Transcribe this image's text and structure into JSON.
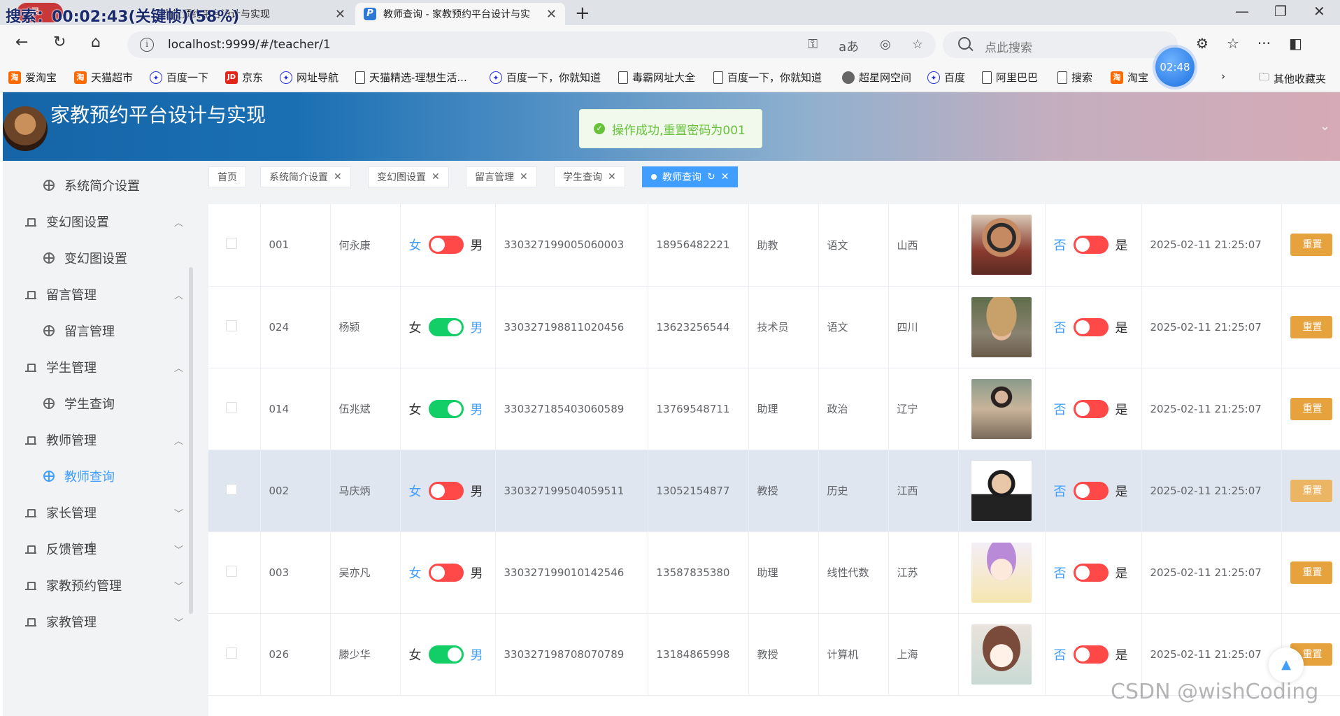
{
  "overlay": {
    "recording_text": "搜索：00:02:43(关键帧)(58%)",
    "rec_badge": "录"
  },
  "browser": {
    "inactive_tab": "家教预约平台设计与实现",
    "active_tab": "教师查询 - 家教预约平台设计与实",
    "url": "localhost:9999/#/teacher/1",
    "search_placeholder": "点此搜索",
    "clock": "02:48",
    "bookmarks": [
      {
        "label": "爱淘宝",
        "icon": "taobao-icon"
      },
      {
        "label": "天猫超市",
        "icon": "taobao-icon"
      },
      {
        "label": "百度一下",
        "icon": "baidu-icon"
      },
      {
        "label": "京东",
        "icon": "jd-icon"
      },
      {
        "label": "网址导航",
        "icon": "baidu-icon"
      },
      {
        "label": "天猫精选-理想生活...",
        "icon": "doc-icon"
      },
      {
        "label": "百度一下，你就知道",
        "icon": "baidu-icon"
      },
      {
        "label": "毒霸网址大全",
        "icon": "doc-icon"
      },
      {
        "label": "百度一下，你就知道",
        "icon": "doc-icon"
      },
      {
        "label": "超星网空间",
        "icon": "globe-icon"
      },
      {
        "label": "百度",
        "icon": "baidu-icon"
      },
      {
        "label": "阿里巴巴",
        "icon": "doc-icon"
      },
      {
        "label": "搜索",
        "icon": "doc-icon"
      },
      {
        "label": "淘宝",
        "icon": "taobao-icon"
      }
    ],
    "other_bookmarks": "其他收藏夹"
  },
  "app": {
    "title": "家教预约平台设计与实现",
    "toast": "操作成功,重置密码为001",
    "accent": "#409eff",
    "warning": "#e6a23c"
  },
  "sidebar": {
    "items": [
      {
        "type": "sub",
        "label": "系统简介设置"
      },
      {
        "type": "group",
        "label": "变幻图设置",
        "expanded": true
      },
      {
        "type": "sub",
        "label": "变幻图设置"
      },
      {
        "type": "group",
        "label": "留言管理",
        "expanded": true
      },
      {
        "type": "sub",
        "label": "留言管理"
      },
      {
        "type": "group",
        "label": "学生管理",
        "expanded": true
      },
      {
        "type": "sub",
        "label": "学生查询"
      },
      {
        "type": "group",
        "label": "教师管理",
        "expanded": true
      },
      {
        "type": "sub",
        "label": "教师查询",
        "active": true
      },
      {
        "type": "group",
        "label": "家长管理",
        "expanded": false
      },
      {
        "type": "group",
        "label": "反馈管理",
        "expanded": false
      },
      {
        "type": "group",
        "label": "家教预约管理",
        "expanded": false
      },
      {
        "type": "group",
        "label": "家教管理",
        "expanded": false
      }
    ]
  },
  "tags": [
    {
      "label": "首页",
      "closable": false
    },
    {
      "label": "系统简介设置",
      "closable": true
    },
    {
      "label": "变幻图设置",
      "closable": true
    },
    {
      "label": "留言管理",
      "closable": true
    },
    {
      "label": "学生查询",
      "closable": true
    },
    {
      "label": "教师查询",
      "closable": true,
      "active": true
    }
  ],
  "table": {
    "switch_female": "女",
    "switch_male": "男",
    "switch_no": "否",
    "switch_yes": "是",
    "reset_label": "重置",
    "rows": [
      {
        "id": "001",
        "name": "何永康",
        "gender": "女",
        "idcard": "330327199005060003",
        "phone": "18956482221",
        "title": "助教",
        "subject": "语文",
        "province": "山西",
        "photo": "photo-man-sunglasses",
        "recommended": "否",
        "time": "2025-02-11 21:25:07"
      },
      {
        "id": "024",
        "name": "杨颍",
        "gender": "男",
        "idcard": "330327198811020456",
        "phone": "13623256544",
        "title": "技术员",
        "subject": "语文",
        "province": "四川",
        "photo": "photo-woman-hat",
        "recommended": "否",
        "time": "2025-02-11 21:25:07"
      },
      {
        "id": "014",
        "name": "伍兆斌",
        "gender": "男",
        "idcard": "330327185403060589",
        "phone": "13769548711",
        "title": "助理",
        "subject": "政治",
        "province": "辽宁",
        "photo": "photo-woman-street",
        "recommended": "否",
        "time": "2025-02-11 21:25:07"
      },
      {
        "id": "002",
        "name": "马庆炳",
        "gender": "女",
        "idcard": "330327199504059511",
        "phone": "13052154877",
        "title": "教授",
        "subject": "历史",
        "province": "江西",
        "photo": "photo-man-portrait",
        "recommended": "否",
        "time": "2025-02-11 21:25:07",
        "hover": true
      },
      {
        "id": "003",
        "name": "吴亦凡",
        "gender": "女",
        "idcard": "330327199010142546",
        "phone": "13587835380",
        "title": "助理",
        "subject": "线性代数",
        "province": "江苏",
        "photo": "photo-anime-boy",
        "recommended": "否",
        "time": "2025-02-11 21:25:07"
      },
      {
        "id": "026",
        "name": "滕少华",
        "gender": "男",
        "idcard": "330327198708070789",
        "phone": "13184865998",
        "title": "教授",
        "subject": "计算机",
        "province": "上海",
        "photo": "photo-anime-girl",
        "recommended": "否",
        "time": "2025-02-11 21:25:07"
      }
    ]
  },
  "watermark": "CSDN @wishCoding"
}
